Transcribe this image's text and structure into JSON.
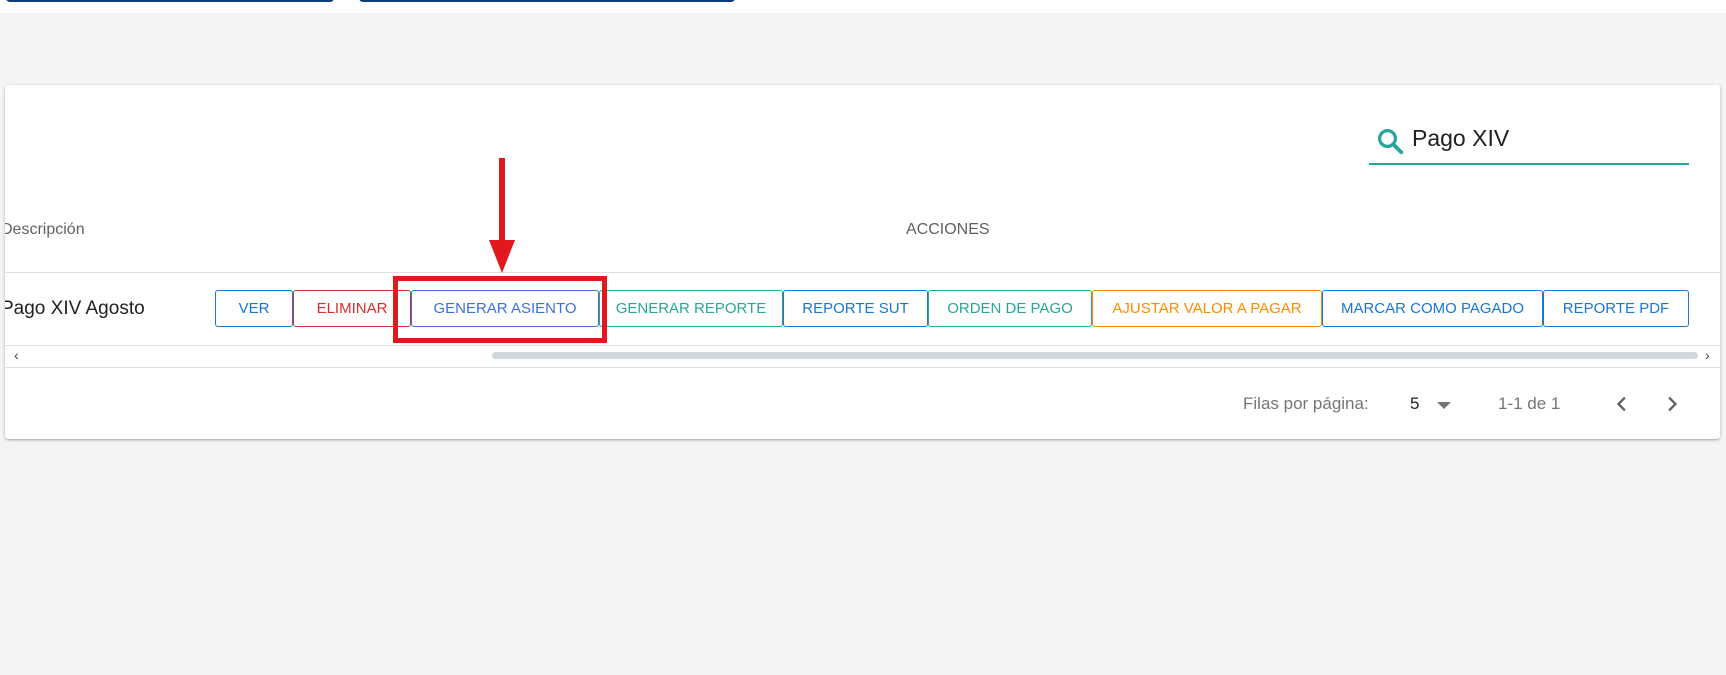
{
  "search": {
    "value": "Pago XIV"
  },
  "table": {
    "headers": {
      "description": "Descripción",
      "actions": "ACCIONES"
    },
    "rows": [
      {
        "description": "Pago XIV Agosto"
      }
    ],
    "actions": [
      {
        "label": "VER",
        "color": "#1976d2"
      },
      {
        "label": "ELIMINAR",
        "color": "#d32f2f"
      },
      {
        "label": "GENERAR ASIENTO",
        "color": "#3f6fd8"
      },
      {
        "label": "GENERAR REPORTE",
        "color": "#26a69a"
      },
      {
        "label": "REPORTE SUT",
        "color": "#1976d2"
      },
      {
        "label": "ORDEN DE PAGO",
        "color": "#26a69a"
      },
      {
        "label": "AJUSTAR VALOR A PAGAR",
        "color": "#fb8c00"
      },
      {
        "label": "MARCAR COMO PAGADO",
        "color": "#1976d2"
      },
      {
        "label": "REPORTE PDF",
        "color": "#1976d2"
      }
    ]
  },
  "scrollbar": {
    "left_arrow": "‹",
    "right_arrow": "›"
  },
  "pagination": {
    "rows_per_page_label": "Filas por página:",
    "rows_per_page_value": "5",
    "range_text": "1-1 de 1"
  },
  "annotation": {
    "color": "#e0191f",
    "highlighted_action": "GENERAR ASIENTO"
  },
  "icons": {
    "search": "search-icon",
    "dropdown": "caret-down-icon",
    "prev": "chevron-left-icon",
    "next": "chevron-right-icon"
  }
}
